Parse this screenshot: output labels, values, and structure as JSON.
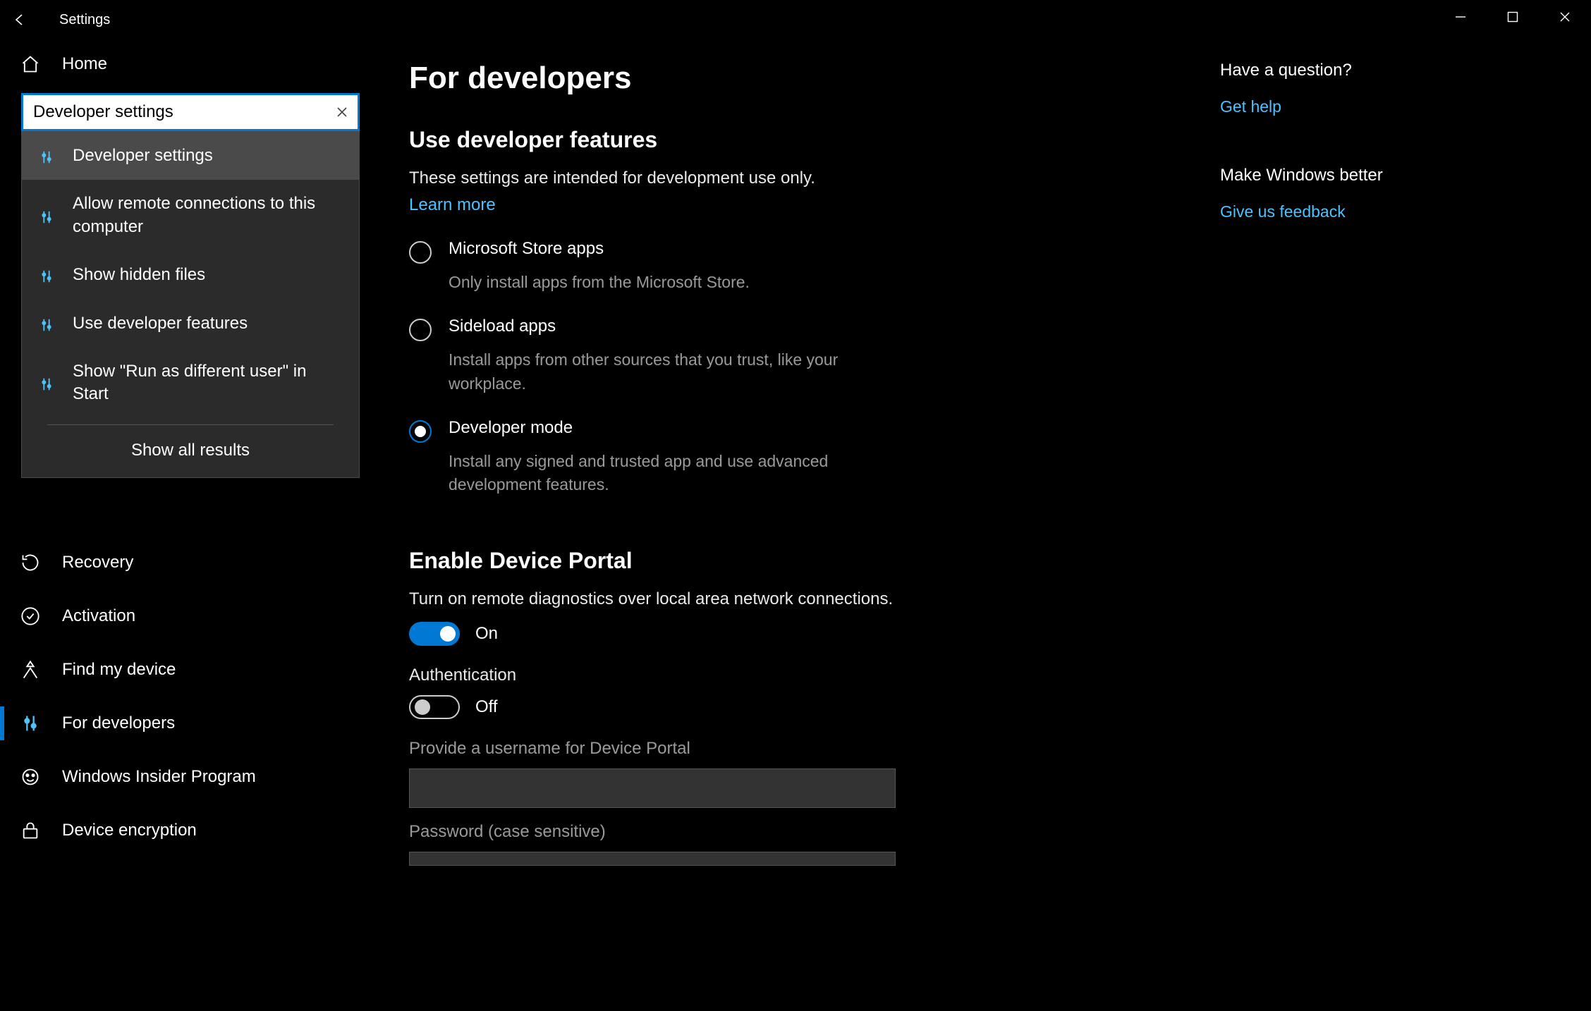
{
  "titlebar": {
    "title": "Settings"
  },
  "sidebar": {
    "home": "Home",
    "search_value": "Developer settings",
    "dropdown": {
      "items": [
        "Developer settings",
        "Allow remote connections to this computer",
        "Show hidden files",
        "Use developer features",
        "Show \"Run as different user\" in Start"
      ],
      "show_all": "Show all results"
    },
    "nav": [
      "Recovery",
      "Activation",
      "Find my device",
      "For developers",
      "Windows Insider Program",
      "Device encryption"
    ]
  },
  "main": {
    "page_title": "For developers",
    "section1_title": "Use developer features",
    "section1_desc": "These settings are intended for development use only.",
    "learn_more": "Learn more",
    "radios": [
      {
        "label": "Microsoft Store apps",
        "desc": "Only install apps from the Microsoft Store."
      },
      {
        "label": "Sideload apps",
        "desc": "Install apps from other sources that you trust, like your workplace."
      },
      {
        "label": "Developer mode",
        "desc": "Install any signed and trusted app and use advanced development features."
      }
    ],
    "section2_title": "Enable Device Portal",
    "section2_desc": "Turn on remote diagnostics over local area network connections.",
    "toggle1_state": "On",
    "auth_label": "Authentication",
    "toggle2_state": "Off",
    "username_label": "Provide a username for Device Portal",
    "password_label": "Password (case sensitive)"
  },
  "help": {
    "q_title": "Have a question?",
    "q_link": "Get help",
    "f_title": "Make Windows better",
    "f_link": "Give us feedback"
  }
}
